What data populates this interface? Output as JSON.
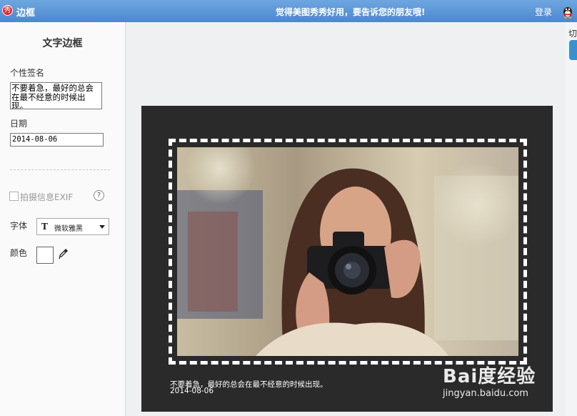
{
  "titlebar": {
    "logo_char": "秀",
    "title": "边框",
    "slogan": "觉得美图秀秀好用，要告诉您的朋友哦!",
    "login_label": "登录",
    "login_icon": "qq-penguin-icon"
  },
  "panel": {
    "title": "文字边框",
    "signature_label": "个性签名",
    "signature_value": "不要着急，最好的总会在最不经意的时候出现。",
    "date_label": "日期",
    "date_value": "2014-08-06",
    "exif_label": "拍摄信息EXIF",
    "exif_checked": false,
    "help_glyph": "?",
    "font_label": "字体",
    "font_icon_glyph": "T",
    "font_value": "微软雅黑",
    "color_label": "颜色",
    "color_value": "#ffffff",
    "eyedropper_icon": "eyedropper-icon"
  },
  "canvas": {
    "background": "#2a2a2a",
    "border_style": "white dashed",
    "caption_text": "不要着急，最好的总会在最不经意的时候出现。",
    "caption_date": "2014-08-06"
  },
  "right_strip": {
    "tab_label": "切"
  },
  "watermark": {
    "brand": "Bai度经验",
    "url": "jingyan.baidu.com"
  }
}
